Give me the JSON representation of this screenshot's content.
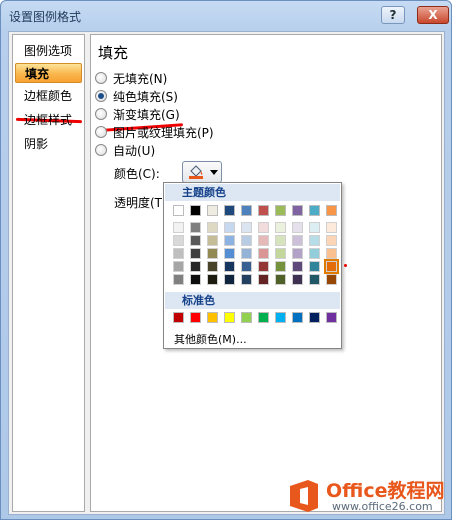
{
  "window": {
    "title": "设置图例格式",
    "help_label": "?",
    "close_label": "X"
  },
  "nav": {
    "items": [
      {
        "label": "图例选项",
        "active": false
      },
      {
        "label": "填充",
        "active": true
      },
      {
        "label": "边框颜色",
        "active": false
      },
      {
        "label": "边框样式",
        "active": false
      },
      {
        "label": "阴影",
        "active": false
      }
    ]
  },
  "content": {
    "heading": "填充",
    "options": [
      {
        "label": "无填充(N)",
        "checked": false
      },
      {
        "label": "纯色填充(S)",
        "checked": true
      },
      {
        "label": "渐变填充(G)",
        "checked": false
      },
      {
        "label": "图片或纹理填充(P)",
        "checked": false
      },
      {
        "label": "自动(U)",
        "checked": false
      }
    ],
    "color_label": "颜色(C):",
    "transparency_label": "透明度(T):"
  },
  "palette": {
    "theme_header": "主题颜色",
    "standard_header": "标准色",
    "more_label": "其他颜色(M)...",
    "theme_top": [
      "#ffffff",
      "#000000",
      "#eeece1",
      "#1f497d",
      "#4f81bd",
      "#c0504d",
      "#9bbb59",
      "#8064a2",
      "#4bacc6",
      "#f79646"
    ],
    "theme_shades": [
      [
        "#f2f2f2",
        "#d9d9d9",
        "#bfbfbf",
        "#a6a6a6",
        "#808080"
      ],
      [
        "#7f7f7f",
        "#595959",
        "#404040",
        "#262626",
        "#0d0d0d"
      ],
      [
        "#ddd9c3",
        "#c4bd97",
        "#938953",
        "#494429",
        "#1d1b10"
      ],
      [
        "#c6d9f0",
        "#8db3e2",
        "#548dd4",
        "#17365d",
        "#0f243e"
      ],
      [
        "#dbe5f1",
        "#b8cce4",
        "#95b3d7",
        "#366092",
        "#244061"
      ],
      [
        "#f2dcdb",
        "#e5b9b7",
        "#d99694",
        "#953734",
        "#632423"
      ],
      [
        "#ebf1dd",
        "#d7e3bc",
        "#c3d69b",
        "#76923c",
        "#4f6128"
      ],
      [
        "#e5e0ec",
        "#ccc1d9",
        "#b2a2c7",
        "#5f497a",
        "#3f3151"
      ],
      [
        "#dbeef3",
        "#b7dde8",
        "#92cddc",
        "#31859b",
        "#205867"
      ],
      [
        "#fdeada",
        "#fbd5b5",
        "#fac08f",
        "#e36c09",
        "#974806"
      ]
    ],
    "standard": [
      "#c00000",
      "#ff0000",
      "#ffc000",
      "#ffff00",
      "#92d050",
      "#00b050",
      "#00b0f0",
      "#0070c0",
      "#002060",
      "#7030a0"
    ],
    "selected_swatch": "theme-9-3"
  },
  "brand": {
    "name": "Office教程网",
    "url": "www.office26.com",
    "accent": "#e8571c"
  }
}
